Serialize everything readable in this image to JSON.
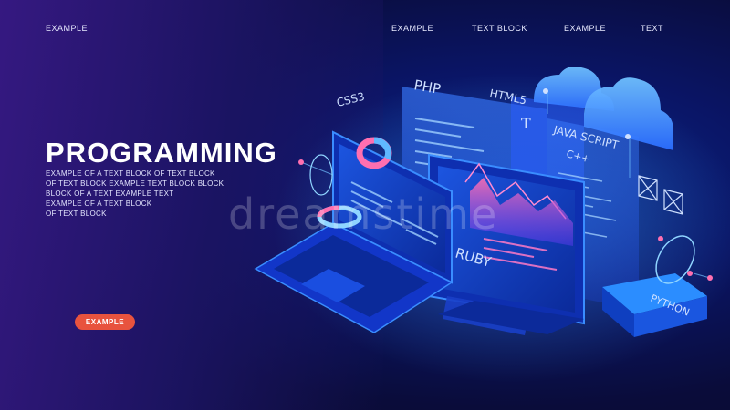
{
  "nav": {
    "items": [
      {
        "label": "EXAMPLE"
      },
      {
        "label": "EXAMPLE"
      },
      {
        "label": "TEXT BLOCK"
      },
      {
        "label": "EXAMPLE"
      },
      {
        "label": "TEXT"
      }
    ]
  },
  "hero": {
    "title": "PROGRAMMING",
    "description_lines": [
      "EXAMPLE OF A TEXT BLOCK OF TEXT BLOCK",
      "OF TEXT BLOCK  EXAMPLE  TEXT BLOCK BLOCK",
      "BLOCK OF A TEXT EXAMPLE TEXT",
      "EXAMPLE OF A TEXT BLOCK",
      "OF TEXT BLOCK"
    ],
    "button_label": "EXAMPLE"
  },
  "illustration": {
    "languages": {
      "php": "PHP",
      "html": "HTML5",
      "css": "CSS3",
      "javascript": "JAVA SCRIPT",
      "cpp": "C++",
      "ruby": "RUBY",
      "python": "PYTHON"
    },
    "watermark": "dreamstime"
  },
  "colors": {
    "accent": "#e8533e",
    "background": "#0a1566",
    "glow": "#3fa9ff"
  }
}
